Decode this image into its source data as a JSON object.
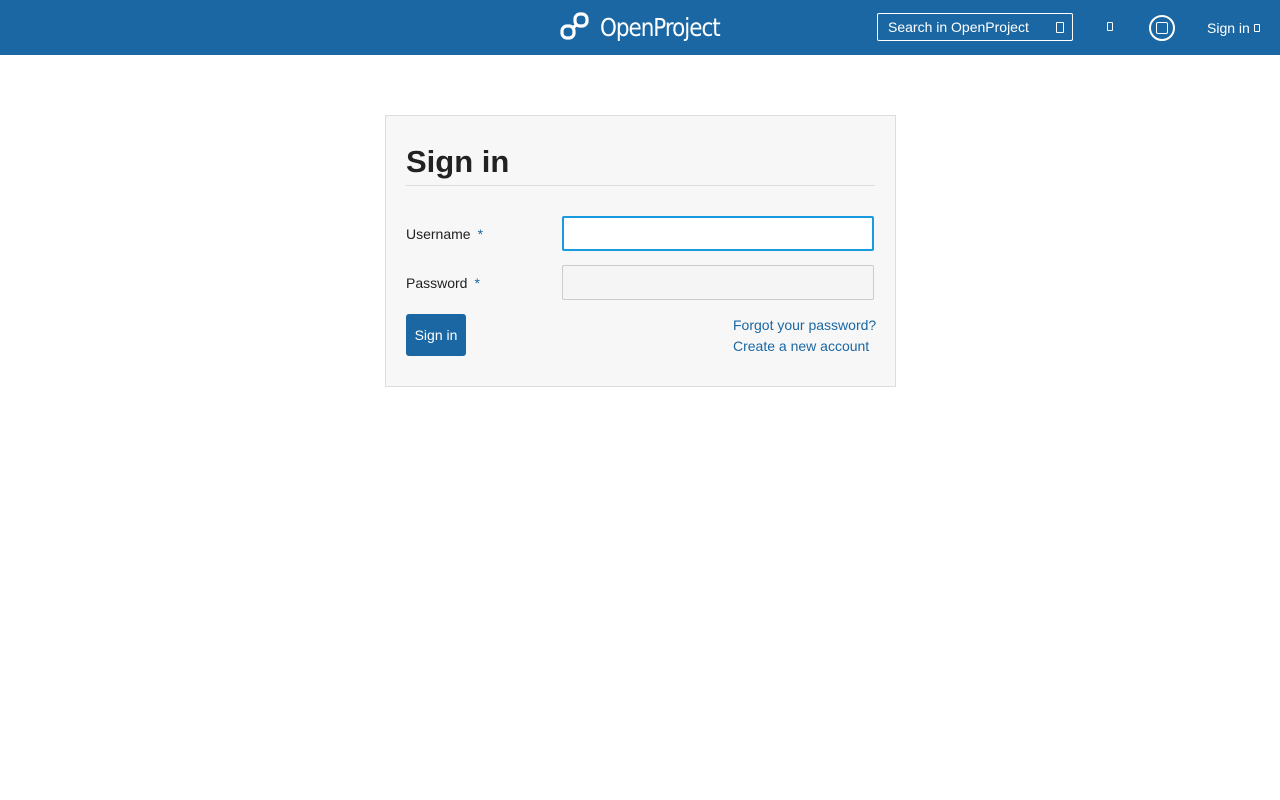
{
  "header": {
    "brand": "OpenProject",
    "search_placeholder": "Search in OpenProject",
    "signin_label": "Sign in",
    "icons": {
      "logo": "openproject-logo-icon",
      "search": "search-icon",
      "modules": "grid-icon",
      "help": "help-icon",
      "caret": "caret-down-icon"
    }
  },
  "login": {
    "title": "Sign in",
    "username_label": "Username",
    "password_label": "Password",
    "required_marker": "*",
    "username_value": "",
    "password_value": "",
    "submit_label": "Sign in",
    "forgot_password": "Forgot your password?",
    "create_account": "Create a new account"
  },
  "colors": {
    "header_bg": "#1a67a3",
    "accent": "#1a67a3",
    "focus": "#1a9be0",
    "panel_bg": "#f7f7f7"
  }
}
